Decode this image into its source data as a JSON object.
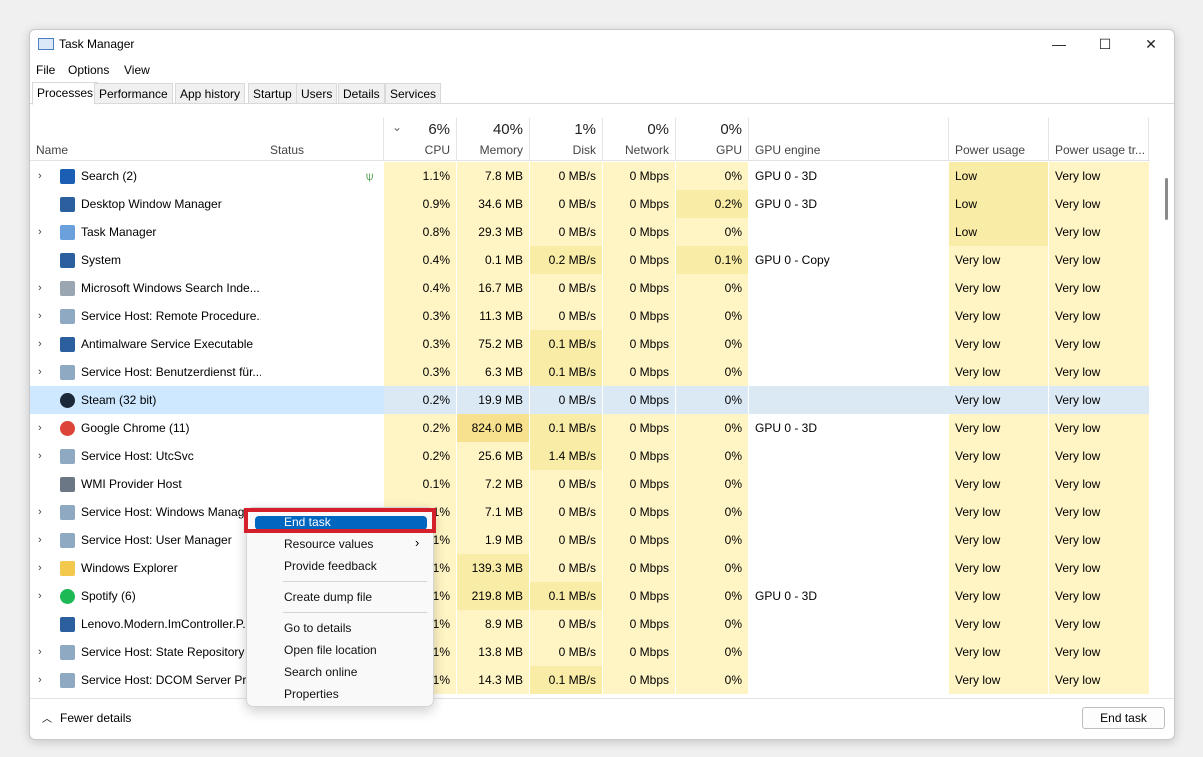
{
  "window": {
    "title": "Task Manager",
    "minimize": "—",
    "maximize": "☐",
    "close": "✕"
  },
  "menu": [
    "File",
    "Options",
    "View"
  ],
  "tabs": [
    "Processes",
    "Performance",
    "App history",
    "Startup",
    "Users",
    "Details",
    "Services"
  ],
  "active_tab": "Processes",
  "columns": [
    {
      "label": "Name",
      "pct": ""
    },
    {
      "label": "Status",
      "pct": ""
    },
    {
      "label": "CPU",
      "pct": "6%"
    },
    {
      "label": "Memory",
      "pct": "40%"
    },
    {
      "label": "Disk",
      "pct": "1%"
    },
    {
      "label": "Network",
      "pct": "0%"
    },
    {
      "label": "GPU",
      "pct": "0%"
    },
    {
      "label": "GPU engine",
      "pct": ""
    },
    {
      "label": "Power usage",
      "pct": ""
    },
    {
      "label": "Power usage tr...",
      "pct": ""
    }
  ],
  "sort_indicator": "⌄",
  "processes": [
    {
      "name": "Search (2)",
      "exp": true,
      "icon": "search-icon",
      "status_icon": "leaf-icon",
      "cpu": "1.1%",
      "mem": "7.8 MB",
      "disk": "0 MB/s",
      "net": "0 Mbps",
      "gpu": "0%",
      "eng": "GPU 0 - 3D",
      "pow": "Low",
      "trend": "Very low"
    },
    {
      "name": "Desktop Window Manager",
      "exp": false,
      "icon": "app-icon",
      "cpu": "0.9%",
      "mem": "34.6 MB",
      "disk": "0 MB/s",
      "net": "0 Mbps",
      "gpu": "0.2%",
      "eng": "GPU 0 - 3D",
      "pow": "Low",
      "trend": "Very low"
    },
    {
      "name": "Task Manager",
      "exp": true,
      "icon": "task-manager-icon",
      "cpu": "0.8%",
      "mem": "29.3 MB",
      "disk": "0 MB/s",
      "net": "0 Mbps",
      "gpu": "0%",
      "eng": "",
      "pow": "Low",
      "trend": "Very low"
    },
    {
      "name": "System",
      "exp": false,
      "icon": "app-icon",
      "cpu": "0.4%",
      "mem": "0.1 MB",
      "disk": "0.2 MB/s",
      "net": "0 Mbps",
      "gpu": "0.1%",
      "eng": "GPU 0 - Copy",
      "pow": "Very low",
      "trend": "Very low"
    },
    {
      "name": "Microsoft Windows Search Inde...",
      "exp": true,
      "icon": "search-indexer-icon",
      "cpu": "0.4%",
      "mem": "16.7 MB",
      "disk": "0 MB/s",
      "net": "0 Mbps",
      "gpu": "0%",
      "eng": "",
      "pow": "Very low",
      "trend": "Very low"
    },
    {
      "name": "Service Host: Remote Procedure...",
      "exp": true,
      "icon": "gear-icon",
      "cpu": "0.3%",
      "mem": "11.3 MB",
      "disk": "0 MB/s",
      "net": "0 Mbps",
      "gpu": "0%",
      "eng": "",
      "pow": "Very low",
      "trend": "Very low"
    },
    {
      "name": "Antimalware Service Executable",
      "exp": true,
      "icon": "app-icon",
      "cpu": "0.3%",
      "mem": "75.2 MB",
      "disk": "0.1 MB/s",
      "net": "0 Mbps",
      "gpu": "0%",
      "eng": "",
      "pow": "Very low",
      "trend": "Very low"
    },
    {
      "name": "Service Host: Benutzerdienst für...",
      "exp": true,
      "icon": "gear-icon",
      "cpu": "0.3%",
      "mem": "6.3 MB",
      "disk": "0.1 MB/s",
      "net": "0 Mbps",
      "gpu": "0%",
      "eng": "",
      "pow": "Very low",
      "trend": "Very low"
    },
    {
      "name": "Steam (32 bit)",
      "exp": false,
      "icon": "steam-icon",
      "selected": true,
      "cpu": "0.2%",
      "mem": "19.9 MB",
      "disk": "0 MB/s",
      "net": "0 Mbps",
      "gpu": "0%",
      "eng": "",
      "pow": "Very low",
      "trend": "Very low"
    },
    {
      "name": "Google Chrome (11)",
      "exp": true,
      "icon": "chrome-icon",
      "cpu": "0.2%",
      "mem": "824.0 MB",
      "disk": "0.1 MB/s",
      "net": "0 Mbps",
      "gpu": "0%",
      "eng": "GPU 0 - 3D",
      "pow": "Very low",
      "trend": "Very low"
    },
    {
      "name": "Service Host: UtcSvc",
      "exp": true,
      "icon": "gear-icon",
      "cpu": "0.2%",
      "mem": "25.6 MB",
      "disk": "1.4 MB/s",
      "net": "0 Mbps",
      "gpu": "0%",
      "eng": "",
      "pow": "Very low",
      "trend": "Very low"
    },
    {
      "name": "WMI Provider Host",
      "exp": false,
      "icon": "wmi-icon",
      "cpu": "0.1%",
      "mem": "7.2 MB",
      "disk": "0 MB/s",
      "net": "0 Mbps",
      "gpu": "0%",
      "eng": "",
      "pow": "Very low",
      "trend": "Very low"
    },
    {
      "name": "Service Host: Windows Manage...",
      "exp": true,
      "icon": "gear-icon",
      "cpu": "0.1%",
      "mem": "7.1 MB",
      "disk": "0 MB/s",
      "net": "0 Mbps",
      "gpu": "0%",
      "eng": "",
      "pow": "Very low",
      "trend": "Very low"
    },
    {
      "name": "Service Host: User Manager",
      "exp": true,
      "icon": "gear-icon",
      "cpu": "0.1%",
      "mem": "1.9 MB",
      "disk": "0 MB/s",
      "net": "0 Mbps",
      "gpu": "0%",
      "eng": "",
      "pow": "Very low",
      "trend": "Very low"
    },
    {
      "name": "Windows Explorer",
      "exp": true,
      "icon": "folder-icon",
      "cpu": "0.1%",
      "mem": "139.3 MB",
      "disk": "0 MB/s",
      "net": "0 Mbps",
      "gpu": "0%",
      "eng": "",
      "pow": "Very low",
      "trend": "Very low"
    },
    {
      "name": "Spotify (6)",
      "exp": true,
      "icon": "spotify-icon",
      "cpu": "0.1%",
      "mem": "219.8 MB",
      "disk": "0.1 MB/s",
      "net": "0 Mbps",
      "gpu": "0%",
      "eng": "GPU 0 - 3D",
      "pow": "Very low",
      "trend": "Very low"
    },
    {
      "name": "Lenovo.Modern.ImController.P...",
      "exp": false,
      "icon": "app-icon",
      "cpu": "0.1%",
      "mem": "8.9 MB",
      "disk": "0 MB/s",
      "net": "0 Mbps",
      "gpu": "0%",
      "eng": "",
      "pow": "Very low",
      "trend": "Very low"
    },
    {
      "name": "Service Host: State Repository S...",
      "exp": true,
      "icon": "gear-icon",
      "cpu": "0.1%",
      "mem": "13.8 MB",
      "disk": "0 MB/s",
      "net": "0 Mbps",
      "gpu": "0%",
      "eng": "",
      "pow": "Very low",
      "trend": "Very low"
    },
    {
      "name": "Service Host: DCOM Server Proc...",
      "exp": true,
      "icon": "gear-icon",
      "cpu": "0.1%",
      "mem": "14.3 MB",
      "disk": "0.1 MB/s",
      "net": "0 Mbps",
      "gpu": "0%",
      "eng": "",
      "pow": "Very low",
      "trend": "Very low"
    }
  ],
  "context_menu": {
    "items": [
      "End task",
      "Resource values",
      "Provide feedback",
      "Create dump file",
      "Go to details",
      "Open file location",
      "Search online",
      "Properties"
    ],
    "submenu_arrow": "›"
  },
  "footer": {
    "fewer_details": "Fewer details",
    "fewer_icon": "︿",
    "end_task": "End task"
  },
  "colors": {
    "heat_low": "#fff4c4",
    "heat_mid": "#f9eca6",
    "heat_high": "#f7e08e",
    "selected": "#cde8ff",
    "accent": "#0067c0",
    "highlight_box": "#d3202a"
  }
}
